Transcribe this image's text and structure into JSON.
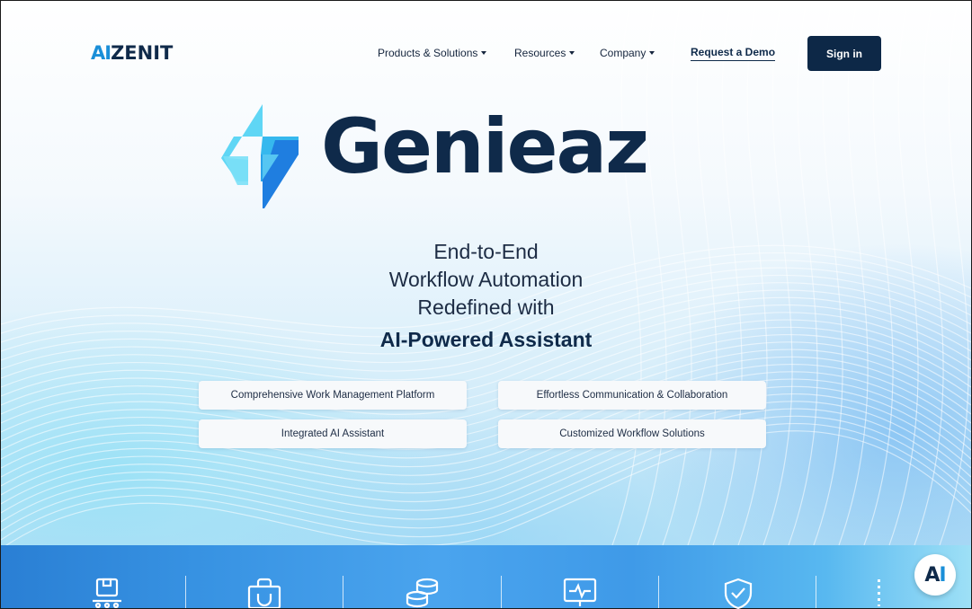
{
  "header": {
    "logo_ai": "AI",
    "logo_text": "ZENIT",
    "nav": [
      {
        "label": "Products & Solutions"
      },
      {
        "label": "Resources"
      },
      {
        "label": "Company"
      }
    ],
    "demo_label": "Request a Demo",
    "signin_label": "Sign in"
  },
  "hero": {
    "brand_name": "Genieaz",
    "tagline_lines": [
      "End-to-End",
      "Workflow Automation",
      "Redefined with"
    ],
    "tagline_strong": "AI-Powered Assistant",
    "features": [
      "Comprehensive Work Management Platform",
      "Effortless Communication & Collaboration",
      "Integrated AI Assistant",
      "Customized Workflow Solutions"
    ]
  },
  "band": {
    "icons": [
      "inventory-box-icon",
      "shopping-bag-icon",
      "coins-stack-icon",
      "monitor-pulse-icon",
      "shield-check-icon"
    ]
  },
  "chat": {
    "label_a": "A",
    "label_i": "I"
  },
  "colors": {
    "navy": "#0d2847",
    "accent": "#1a8fd8",
    "band_blue": "#3792e2"
  }
}
